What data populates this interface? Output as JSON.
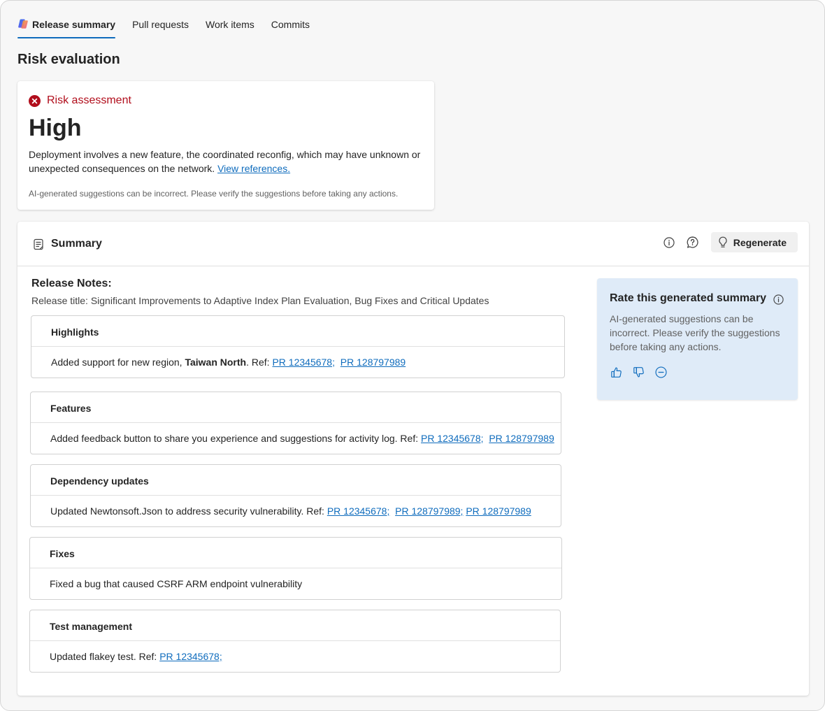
{
  "tabs": [
    {
      "label": "Release summary",
      "active": true
    },
    {
      "label": "Pull requests",
      "active": false
    },
    {
      "label": "Work items",
      "active": false
    },
    {
      "label": "Commits",
      "active": false
    }
  ],
  "page_title": "Risk evaluation",
  "risk": {
    "heading": "Risk assessment",
    "level": "High",
    "description": "Deployment involves a new feature, the coordinated reconfig, which may have unknown or unexpected consequences on the network.",
    "link": "View references.",
    "disclaimer": "AI-generated suggestions can be incorrect. Please verify the suggestions before taking any actions.",
    "status_color": "#b10e1c"
  },
  "summary": {
    "title": "Summary",
    "regenerate_label": "Regenerate",
    "notes_heading": "Release Notes:",
    "release_title": "Release title: Significant Improvements to Adaptive Index Plan Evaluation, Bug Fixes and Critical Updates",
    "sections": [
      {
        "heading": "Highlights",
        "text_before": "Added support for new region, ",
        "bold": "Taiwan North",
        "text_after": ". Ref: ",
        "refs": [
          "PR 12345678;",
          "PR 128797989"
        ]
      },
      {
        "heading": "Features",
        "text_before": "Added feedback button to share you experience and suggestions for activity log. Ref: ",
        "refs": [
          "PR 12345678;",
          "PR 128797989"
        ]
      },
      {
        "heading": "Dependency updates",
        "text_before": "Updated Newtonsoft.Json to address security vulnerability. Ref: ",
        "refs": [
          "PR 12345678;",
          "PR 128797989;",
          "PR 128797989"
        ]
      },
      {
        "heading": "Fixes",
        "text_before": "Fixed a bug that caused CSRF ARM endpoint vulnerability",
        "refs": []
      },
      {
        "heading": "Test management",
        "text_before": "Updated flakey test. Ref: ",
        "refs": [
          "PR 12345678;"
        ]
      }
    ]
  },
  "rating": {
    "title": "Rate this generated summary",
    "text": "AI-generated suggestions can be incorrect. Please verify the suggestions before taking any actions."
  },
  "colors": {
    "accent": "#0f6cbd",
    "rate_bg": "#dfebf8"
  }
}
